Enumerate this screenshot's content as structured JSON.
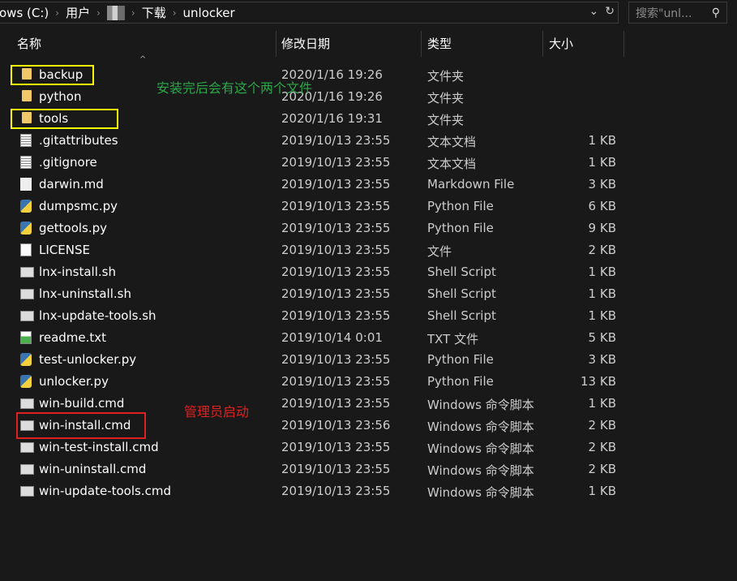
{
  "address": {
    "crumbs": [
      "ows (C:)",
      "用户",
      "下载",
      "unlocker"
    ],
    "refresh_icon": "refresh-icon",
    "dropdown_icon": "chevron-down-icon"
  },
  "search": {
    "placeholder": "搜索\"unl...",
    "icon": "search-icon"
  },
  "columns": {
    "name": "名称",
    "date": "修改日期",
    "type": "类型",
    "size": "大小"
  },
  "annotations": {
    "green": "安装完后会有这个两个文件",
    "red": "管理员启动"
  },
  "colors": {
    "highlight_yellow": "#ffff00",
    "highlight_red": "#e02020",
    "note_green": "#2aa84a"
  },
  "files": [
    {
      "name": "backup",
      "date": "2020/1/16 19:26",
      "type": "文件夹",
      "size": "",
      "icon": "folder",
      "highlight": "yellow"
    },
    {
      "name": "python",
      "date": "2020/1/16 19:26",
      "type": "文件夹",
      "size": "",
      "icon": "folder"
    },
    {
      "name": "tools",
      "date": "2020/1/16 19:31",
      "type": "文件夹",
      "size": "",
      "icon": "folder",
      "highlight": "yellow"
    },
    {
      "name": ".gitattributes",
      "date": "2019/10/13 23:55",
      "type": "文本文档",
      "size": "1 KB",
      "icon": "doc"
    },
    {
      "name": ".gitignore",
      "date": "2019/10/13 23:55",
      "type": "文本文档",
      "size": "1 KB",
      "icon": "doc"
    },
    {
      "name": "darwin.md",
      "date": "2019/10/13 23:55",
      "type": "Markdown File",
      "size": "3 KB",
      "icon": "md"
    },
    {
      "name": "dumpsmc.py",
      "date": "2019/10/13 23:55",
      "type": "Python File",
      "size": "6 KB",
      "icon": "py"
    },
    {
      "name": "gettools.py",
      "date": "2019/10/13 23:55",
      "type": "Python File",
      "size": "9 KB",
      "icon": "py"
    },
    {
      "name": "LICENSE",
      "date": "2019/10/13 23:55",
      "type": "文件",
      "size": "2 KB",
      "icon": "blank"
    },
    {
      "name": "lnx-install.sh",
      "date": "2019/10/13 23:55",
      "type": "Shell Script",
      "size": "1 KB",
      "icon": "cmd"
    },
    {
      "name": "lnx-uninstall.sh",
      "date": "2019/10/13 23:55",
      "type": "Shell Script",
      "size": "1 KB",
      "icon": "cmd"
    },
    {
      "name": "lnx-update-tools.sh",
      "date": "2019/10/13 23:55",
      "type": "Shell Script",
      "size": "1 KB",
      "icon": "cmd"
    },
    {
      "name": "readme.txt",
      "date": "2019/10/14 0:01",
      "type": "TXT 文件",
      "size": "5 KB",
      "icon": "txt"
    },
    {
      "name": "test-unlocker.py",
      "date": "2019/10/13 23:55",
      "type": "Python File",
      "size": "3 KB",
      "icon": "py"
    },
    {
      "name": "unlocker.py",
      "date": "2019/10/13 23:55",
      "type": "Python File",
      "size": "13 KB",
      "icon": "py"
    },
    {
      "name": "win-build.cmd",
      "date": "2019/10/13 23:55",
      "type": "Windows 命令脚本",
      "size": "1 KB",
      "icon": "cmd"
    },
    {
      "name": "win-install.cmd",
      "date": "2019/10/13 23:56",
      "type": "Windows 命令脚本",
      "size": "2 KB",
      "icon": "cmd",
      "highlight": "red"
    },
    {
      "name": "win-test-install.cmd",
      "date": "2019/10/13 23:55",
      "type": "Windows 命令脚本",
      "size": "2 KB",
      "icon": "cmd"
    },
    {
      "name": "win-uninstall.cmd",
      "date": "2019/10/13 23:55",
      "type": "Windows 命令脚本",
      "size": "2 KB",
      "icon": "cmd"
    },
    {
      "name": "win-update-tools.cmd",
      "date": "2019/10/13 23:55",
      "type": "Windows 命令脚本",
      "size": "1 KB",
      "icon": "cmd"
    }
  ]
}
